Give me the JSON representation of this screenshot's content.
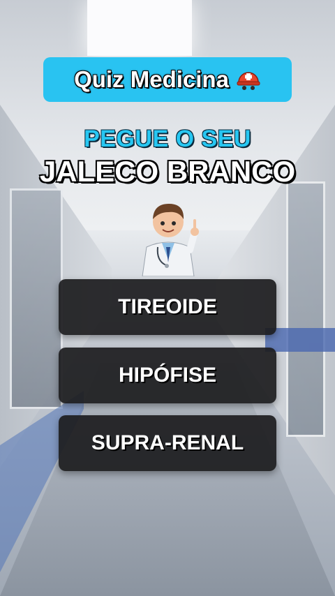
{
  "quiz": {
    "title": "Quiz Medicina",
    "title_icon": "medical-helmet-icon",
    "subtitle_line1": "PEGUE O SEU",
    "subtitle_line2": "JALECO BRANCO",
    "options": [
      {
        "label": "TIREOIDE"
      },
      {
        "label": "HIPÓFISE"
      },
      {
        "label": "SUPRA-RENAL"
      }
    ]
  },
  "colors": {
    "title_pill": "#29c3f1",
    "subtitle_accent": "#27c7f2",
    "option_bg": "#1c1c1e"
  }
}
